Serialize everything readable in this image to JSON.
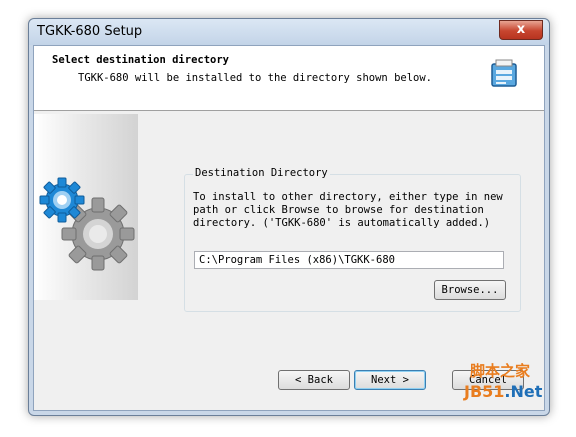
{
  "window": {
    "title": "TGKK-680 Setup",
    "close_glyph": "x"
  },
  "header": {
    "title": "Select destination directory",
    "subtitle": "TGKK-680 will be installed to the directory shown below.",
    "icon": "installer-box-icon"
  },
  "side_art": {
    "icon": "gears-icon",
    "accent_color": "#1e88d6"
  },
  "destination": {
    "legend": "Destination Directory",
    "description": "To install to other directory, either type in new path or click Browse to browse for destination directory. ('TGKK-680' is automatically added.)",
    "path_value": "C:\\Program Files (x86)\\TGKK-680",
    "browse_label": "Browse..."
  },
  "nav": {
    "back_label": "< Back",
    "next_label": "Next >",
    "cancel_label": "Cancel"
  },
  "watermark": {
    "line1": "脚本之家",
    "line2_a": "JB51",
    "line2_b": ".Net"
  }
}
